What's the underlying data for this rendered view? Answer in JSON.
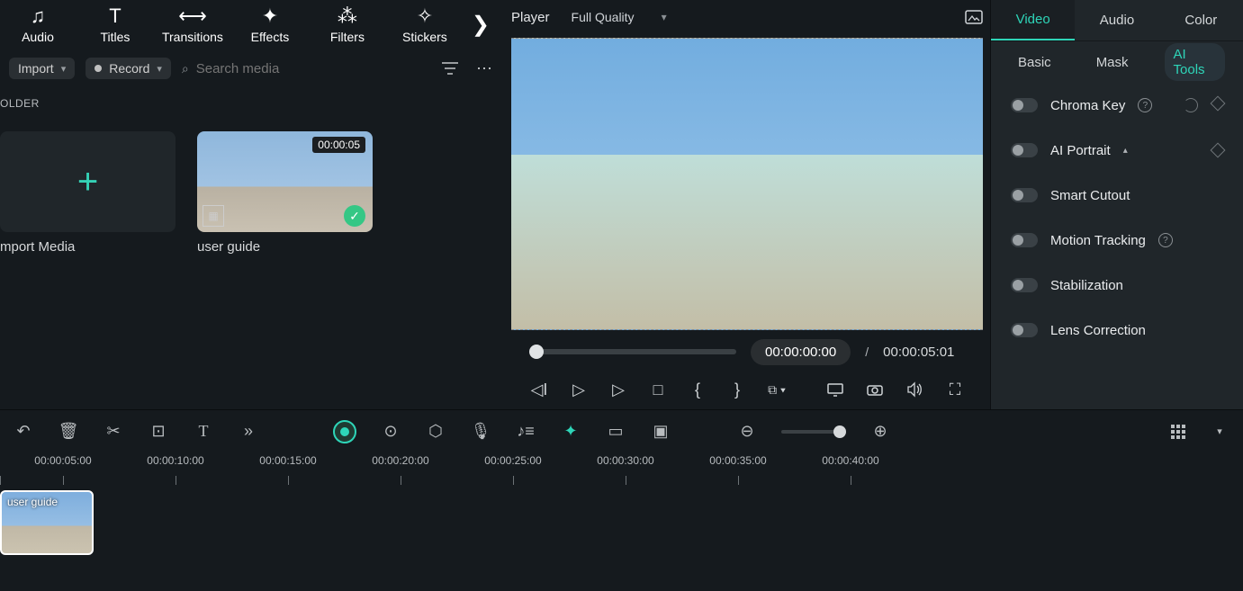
{
  "toolbar": {
    "items": [
      {
        "icon": "audio",
        "label": "Audio"
      },
      {
        "icon": "titles",
        "label": "Titles"
      },
      {
        "icon": "transitions",
        "label": "Transitions"
      },
      {
        "icon": "effects",
        "label": "Effects"
      },
      {
        "icon": "filters",
        "label": "Filters"
      },
      {
        "icon": "stickers",
        "label": "Stickers"
      }
    ]
  },
  "import": {
    "label": "Import",
    "record": "Record"
  },
  "search": {
    "placeholder": "Search media"
  },
  "folder": {
    "label": "OLDER"
  },
  "media": {
    "import_label": "mport Media",
    "clip": {
      "duration": "00:00:05",
      "name": "user guide"
    }
  },
  "player": {
    "title": "Player",
    "quality": "Full Quality",
    "current": "00:00:00:00",
    "total": "00:00:05:01",
    "slash": "/"
  },
  "right": {
    "tabs": [
      "Video",
      "Audio",
      "Color"
    ],
    "subtabs": [
      "Basic",
      "Mask",
      "AI Tools"
    ],
    "tools": [
      {
        "name": "Chroma Key",
        "help": true,
        "reset": true,
        "diamond": true
      },
      {
        "name": "AI Portrait",
        "caret": true,
        "diamond": true
      },
      {
        "name": "Smart Cutout"
      },
      {
        "name": "Motion Tracking",
        "help": true
      },
      {
        "name": "Stabilization"
      },
      {
        "name": "Lens Correction"
      }
    ]
  },
  "timeline": {
    "marks": [
      "",
      "00:00:05:00",
      "00:00:10:00",
      "00:00:15:00",
      "00:00:20:00",
      "00:00:25:00",
      "00:00:30:00",
      "00:00:35:00",
      "00:00:40:00"
    ],
    "clip_name": "user guide"
  }
}
